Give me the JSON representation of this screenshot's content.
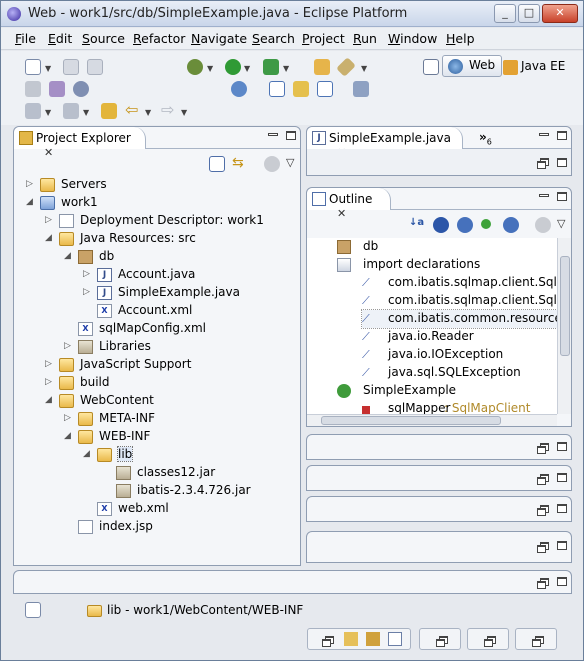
{
  "window": {
    "title": "Web - work1/src/db/SimpleExample.java - Eclipse Platform"
  },
  "menu": [
    "File",
    "Edit",
    "Source",
    "Refactor",
    "Navigate",
    "Search",
    "Project",
    "Run",
    "Window",
    "Help"
  ],
  "perspectives": {
    "web": "Web",
    "java_ee": "Java EE"
  },
  "project_explorer": {
    "tab_label": "Project Explorer",
    "tree": [
      {
        "label": "Servers",
        "icon": "folder-icon"
      },
      {
        "label": "work1",
        "icon": "project-icon"
      },
      {
        "label": "Deployment Descriptor: work1",
        "icon": "deployment-descriptor-icon"
      },
      {
        "label": "Java Resources: src",
        "icon": "java-resources-icon"
      },
      {
        "label": "db",
        "icon": "package-icon"
      },
      {
        "label": "Account.java",
        "icon": "java-file-icon"
      },
      {
        "label": "SimpleExample.java",
        "icon": "java-file-icon"
      },
      {
        "label": "Account.xml",
        "icon": "xml-file-icon"
      },
      {
        "label": "sqlMapConfig.xml",
        "icon": "xml-file-icon"
      },
      {
        "label": "Libraries",
        "icon": "libraries-icon"
      },
      {
        "label": "JavaScript Support",
        "icon": "javascript-support-icon"
      },
      {
        "label": "build",
        "icon": "folder-icon"
      },
      {
        "label": "WebContent",
        "icon": "folder-icon"
      },
      {
        "label": "META-INF",
        "icon": "folder-icon"
      },
      {
        "label": "WEB-INF",
        "icon": "folder-icon"
      },
      {
        "label": "lib",
        "icon": "folder-icon"
      },
      {
        "label": "classes12.jar",
        "icon": "jar-icon"
      },
      {
        "label": "ibatis-2.3.4.726.jar",
        "icon": "jar-icon"
      },
      {
        "label": "web.xml",
        "icon": "xml-file-icon"
      },
      {
        "label": "index.jsp",
        "icon": "file-icon"
      }
    ]
  },
  "editor": {
    "tab_label": "SimpleExample.java",
    "overflow_count": "6"
  },
  "outline": {
    "tab_label": "Outline",
    "items": [
      {
        "label": "db",
        "icon": "package-icon"
      },
      {
        "label": "import declarations",
        "icon": "imports-icon"
      },
      {
        "label": "com.ibatis.sqlmap.client.SqlMa",
        "icon": "import-icon"
      },
      {
        "label": "com.ibatis.sqlmap.client.SqlMa",
        "icon": "import-icon"
      },
      {
        "label": "com.ibatis.common.resources.",
        "icon": "import-icon"
      },
      {
        "label": "java.io.Reader",
        "icon": "import-icon"
      },
      {
        "label": "java.io.IOException",
        "icon": "import-icon"
      },
      {
        "label": "java.sql.SQLException",
        "icon": "import-icon"
      },
      {
        "label": "SimpleExample",
        "icon": "class-icon"
      },
      {
        "label": "sqlMapper",
        "type": ": SqlMapClient",
        "icon": "field-icon"
      }
    ]
  },
  "status": {
    "path": "lib - work1/WebContent/WEB-INF"
  }
}
